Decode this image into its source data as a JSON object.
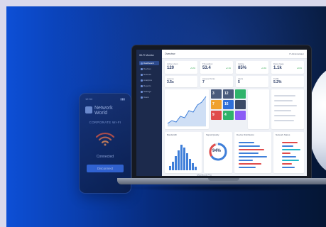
{
  "phone": {
    "time": "12:34",
    "signal": "▮▮▮",
    "brand_line1": "Network",
    "brand_line2": "World",
    "subtitle": "CORPORATE WI-FI",
    "status": "Connected",
    "button": "Disconnect"
  },
  "dashboard": {
    "brand": "Wi-Fi Monitor",
    "page_title": "Overview",
    "user": "IT Administrator",
    "sidebar": [
      "Dashboard",
      "Devices",
      "Network",
      "Analytics",
      "Reports",
      "Settings",
      "Users"
    ],
    "kpis": [
      {
        "label": "Active Users",
        "value": "120",
        "change": "+5.2%"
      },
      {
        "label": "Throughput",
        "value": "53.4",
        "change": "+2.1%"
      },
      {
        "label": "Uptime",
        "value": "85%",
        "change": "+0.4%"
      },
      {
        "label": "Data Usage",
        "value": "1.1k",
        "change": "+8.0%"
      }
    ],
    "row2": [
      {
        "label": "Latency",
        "value": "3.5s"
      },
      {
        "label": "Access Points",
        "value": "7"
      },
      {
        "label": "Alerts",
        "value": "5"
      },
      {
        "label": "Traffic",
        "value": "5.2%"
      }
    ],
    "tiles": [
      "3",
      "12",
      "7",
      "16",
      "9",
      "4"
    ],
    "donut_value": "94%",
    "panels": [
      "Bandwidth",
      "Signal Quality",
      "Device Distribution",
      "Network Status"
    ],
    "laptop_label": "MacBook Pro"
  },
  "colors": {
    "accent": "#3f7fd9",
    "orange": "#f0a12c",
    "red": "#e04b4b",
    "green": "#2fb36a",
    "purple": "#8b5cf6",
    "cyan": "#1fb6c9"
  }
}
